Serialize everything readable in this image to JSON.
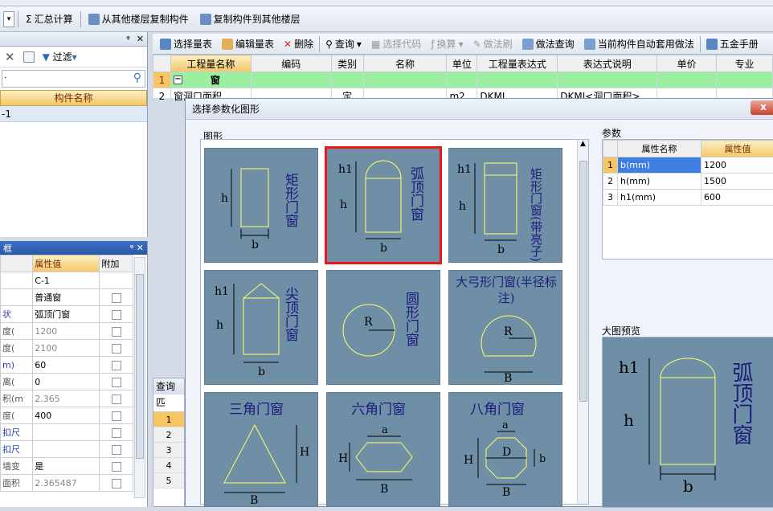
{
  "top_toolbar": {
    "sum_label": "汇总计算",
    "copy_from_label": "从其他楼层复制构件",
    "copy_to_label": "复制构件到其他楼层"
  },
  "left_top": {
    "filter_label": "过滤",
    "header": "构件名称",
    "item": "-1"
  },
  "left_bottom": {
    "header_value": "属性值",
    "header_extra": "附加",
    "rows": [
      {
        "name": "",
        "value": "C-1",
        "has_check": false
      },
      {
        "name": "",
        "value": "普通窗",
        "has_check": true
      },
      {
        "name": "状",
        "value": "弧顶门窗",
        "has_check": true
      },
      {
        "name": "度(",
        "value": "1200",
        "has_check": true
      },
      {
        "name": "度(",
        "value": "2100",
        "has_check": true
      },
      {
        "name": "m)",
        "value": "60",
        "has_check": true
      },
      {
        "name": "离(",
        "value": "0",
        "has_check": true
      },
      {
        "name": "积(m",
        "value": "2.365",
        "has_check": true
      },
      {
        "name": "度(",
        "value": "400",
        "has_check": true
      },
      {
        "name": "扣尺",
        "value": "",
        "has_check": true
      },
      {
        "name": "扣尺",
        "value": "",
        "has_check": true
      },
      {
        "name": "墙变",
        "value": "是",
        "has_check": true
      },
      {
        "name": "面积",
        "value": "2.365487",
        "has_check": true
      }
    ]
  },
  "right_toolbar": {
    "select_qty": "选择量表",
    "edit_qty": "编辑量表",
    "delete": "删除",
    "query": "查询",
    "select_code": "选择代码",
    "convert": "换算",
    "method_brush": "做法刷",
    "method_query": "做法查询",
    "auto_apply": "当前构件自动套用做法",
    "hardware": "五金手册"
  },
  "grid": {
    "headers": [
      "工程量名称",
      "编码",
      "类别",
      "名称",
      "单位",
      "工程量表达式",
      "表达式说明",
      "单价",
      "专业"
    ],
    "row1": {
      "num": "1",
      "name": "窗"
    },
    "row2": {
      "num": "2",
      "name": "窗洞口面积",
      "type": "定",
      "unit": "m2",
      "expr": "DKMJ",
      "desc": "DKMJ<洞口面积>"
    }
  },
  "query_panel": {
    "title": "查询匹",
    "rows": [
      "1",
      "2",
      "3",
      "4",
      "5"
    ]
  },
  "dialog": {
    "title": "选择参数化图形",
    "shapes_label": "图形",
    "params_label": "参数",
    "preview_label": "大图预览",
    "close_label": "x",
    "tiles": [
      {
        "name": "矩形门窗"
      },
      {
        "name": "弧顶门窗"
      },
      {
        "name": "矩形门窗(带亮子)"
      },
      {
        "name": "尖顶门窗"
      },
      {
        "name": "圆形门窗"
      },
      {
        "name": "大弓形门窗(半径标注)"
      },
      {
        "name": "三角门窗"
      },
      {
        "name": "六角门窗"
      },
      {
        "name": "八角门窗"
      }
    ],
    "param_headers": [
      "属性名称",
      "属性值"
    ],
    "params": [
      {
        "num": "1",
        "name": "b(mm)",
        "value": "1200"
      },
      {
        "num": "2",
        "name": "h(mm)",
        "value": "1500"
      },
      {
        "num": "3",
        "name": "h1(mm)",
        "value": "600"
      }
    ],
    "preview_title": "弧顶门窗",
    "dims": {
      "h1": "h1",
      "h": "h",
      "b": "b",
      "R": "R",
      "B": "B",
      "H": "H",
      "a": "a",
      "D": "D"
    }
  },
  "colors": {
    "tile_bg": "#6f8fa7",
    "selected": "#e8191b",
    "grid_green": "#9af0a0",
    "header_orange": "#f7c561"
  }
}
